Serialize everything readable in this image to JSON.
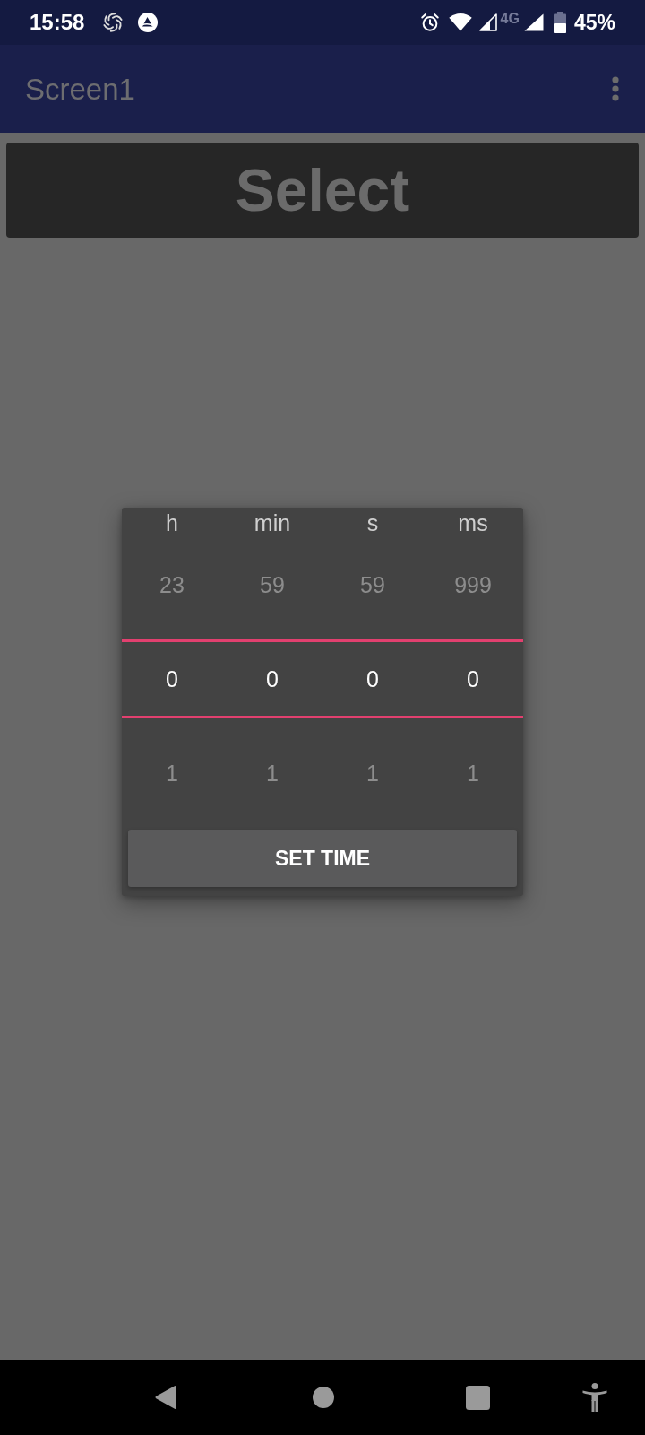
{
  "status_bar": {
    "time": "15:58",
    "network_type": "4G",
    "battery": "45%"
  },
  "app_bar": {
    "title": "Screen1"
  },
  "select_button": {
    "label": "Select"
  },
  "time_picker": {
    "columns": [
      {
        "unit": "h",
        "values": [
          {
            "text": "23",
            "selected": false
          },
          {
            "text": "0",
            "selected": true
          },
          {
            "text": "1",
            "selected": false
          }
        ]
      },
      {
        "unit": "min",
        "values": [
          {
            "text": "59",
            "selected": false
          },
          {
            "text": "0",
            "selected": true
          },
          {
            "text": "1",
            "selected": false
          }
        ]
      },
      {
        "unit": "s",
        "values": [
          {
            "text": "59",
            "selected": false
          },
          {
            "text": "0",
            "selected": true
          },
          {
            "text": "1",
            "selected": false
          }
        ]
      },
      {
        "unit": "ms",
        "values": [
          {
            "text": "999",
            "selected": false
          },
          {
            "text": "0",
            "selected": true
          },
          {
            "text": "1",
            "selected": false
          }
        ]
      }
    ],
    "button": "SET TIME"
  }
}
